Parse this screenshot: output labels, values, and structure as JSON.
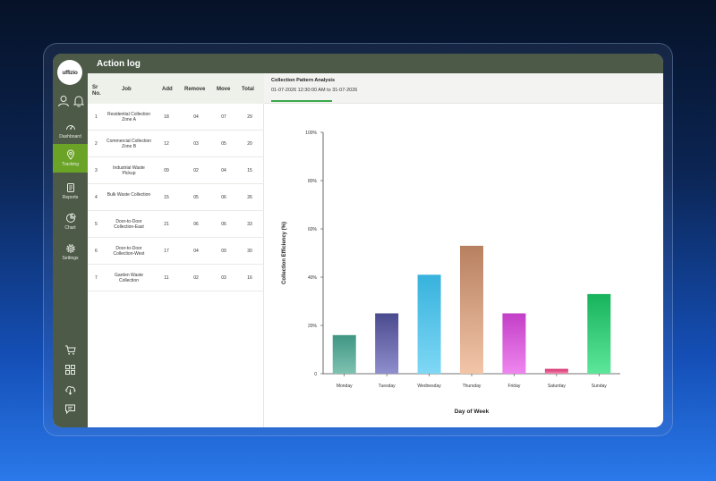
{
  "window": {
    "title": "Action log"
  },
  "sidebar": {
    "logo_text": "uffizio",
    "items": [
      {
        "label": "Dashboard",
        "icon": "dashboard-icon",
        "active": false
      },
      {
        "label": "Tracking",
        "icon": "location-pin-icon",
        "active": true
      },
      {
        "label": "Reports",
        "icon": "report-icon",
        "active": false
      },
      {
        "label": "Chart",
        "icon": "pie-chart-icon",
        "active": false
      },
      {
        "label": "Settings",
        "icon": "gear-icon",
        "active": false
      }
    ],
    "top_icons": [
      "user-icon",
      "bell-icon"
    ],
    "bottom_icons": [
      "cart-icon",
      "grid-icon",
      "cloud-download-icon",
      "chat-icon"
    ]
  },
  "table": {
    "headers": {
      "sr": "Sr No.",
      "job": "Job",
      "add": "Add",
      "remove": "Remove",
      "move": "Move",
      "total": "Total"
    },
    "rows": [
      {
        "sr": "1",
        "job": "Residential Collection Zone  A",
        "add": "18",
        "remove": "04",
        "move": "07",
        "total": "29"
      },
      {
        "sr": "2",
        "job": "Commercial Collection Zone B",
        "add": "12",
        "remove": "03",
        "move": "05",
        "total": "20"
      },
      {
        "sr": "3",
        "job": "Industrial Waste Pickup",
        "add": "09",
        "remove": "02",
        "move": "04",
        "total": "15"
      },
      {
        "sr": "4",
        "job": "Bulk Waste Collection",
        "add": "15",
        "remove": "05",
        "move": "06",
        "total": "26"
      },
      {
        "sr": "5",
        "job": "Door-to-Door Collection-East",
        "add": "21",
        "remove": "06",
        "move": "06",
        "total": "33"
      },
      {
        "sr": "6",
        "job": "Door-to-Door Collection-West",
        "add": "17",
        "remove": "04",
        "move": "09",
        "total": "30"
      },
      {
        "sr": "7",
        "job": "Garden Waste Collection",
        "add": "11",
        "remove": "02",
        "move": "03",
        "total": "16"
      }
    ]
  },
  "analysis": {
    "tab_title": "Collection Pattern Analysis",
    "date_range": "01-07-2026 12:30:00 AM to 31-07-2026"
  },
  "colors": {
    "sidebar_bg": "#4d5a48",
    "active_nav": "#6aa326",
    "tab_underline": "#3aa84a"
  },
  "chart_data": {
    "type": "bar",
    "xlabel": "Day of Week",
    "ylabel": "Collection Efficiency (%)",
    "ylim": [
      0,
      100
    ],
    "yticks": [
      "0",
      "20%",
      "40%",
      "60%",
      "80%",
      "100%"
    ],
    "categories": [
      "Monday",
      "Tuesday",
      "Wednesday",
      "Thursday",
      "Friday",
      "Saturday",
      "Sunday"
    ],
    "values": [
      16,
      25,
      41,
      53,
      25,
      2,
      33
    ],
    "bar_colors": [
      [
        "#3f9683",
        "#7fc1b1"
      ],
      [
        "#4a4a8e",
        "#8f8fce"
      ],
      [
        "#37b2dd",
        "#7fd8f5"
      ],
      [
        "#b78061",
        "#f3c5a8"
      ],
      [
        "#c23fc7",
        "#ef86ef"
      ],
      [
        "#d5296a",
        "#f08cb1"
      ],
      [
        "#17b35c",
        "#5de69a"
      ]
    ],
    "grid": false
  }
}
